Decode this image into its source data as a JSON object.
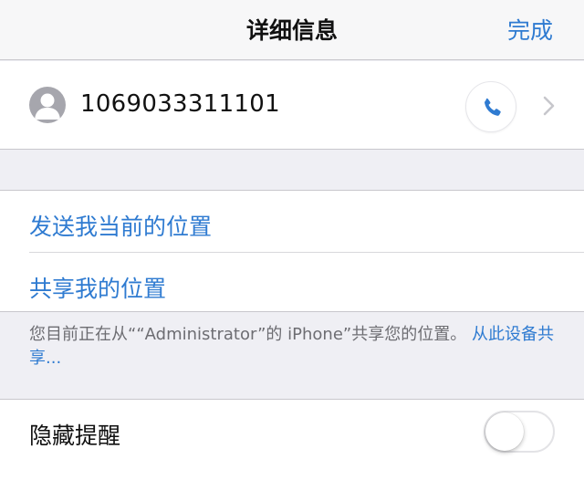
{
  "navbar": {
    "title": "详细信息",
    "done_label": "完成"
  },
  "contact": {
    "number": "1069033311101",
    "avatar_icon": "person-silhouette-icon",
    "call_icon": "phone-icon",
    "chevron_icon": "chevron-right-icon"
  },
  "location": {
    "send_current": "发送我当前的位置",
    "share_location": "共享我的位置"
  },
  "footer": {
    "note_text": "您目前正在从““Administrator”的 iPhone”共享您的位置。",
    "link_text": "从此设备共享..."
  },
  "hide_alerts": {
    "label": "隐藏提醒",
    "enabled": false
  },
  "colors": {
    "accent": "#2f7bd1",
    "background": "#efeff4",
    "secondary_text": "#6d6d72"
  }
}
